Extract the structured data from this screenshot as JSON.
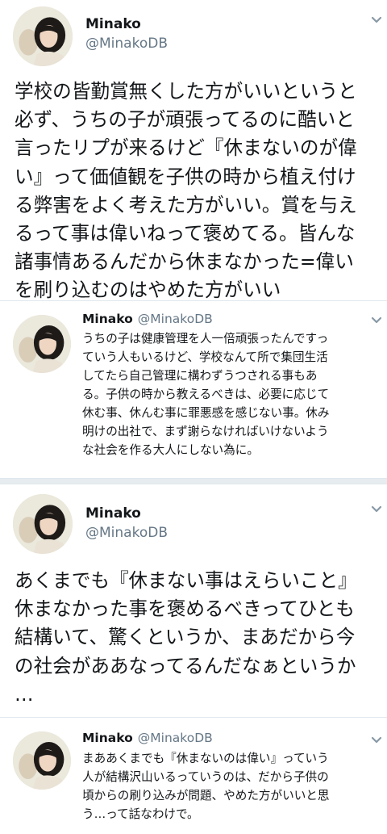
{
  "tweet1": {
    "name": "Minako",
    "handle": "@MinakoDB",
    "text": "学校の皆勤賞無くした方がいいというと\n必ず、うちの子が頑張ってるのに酷いと\n言ったリプが来るけど『休まないのが偉\nい』って価値観を子供の時から植え付け\nる弊害をよく考えた方がいい。賞を与え\nるって事は偉いねって褒めてる。皆んな\n諸事情あるんだから休まなかった=偉い\nを刷り込むのはやめた方がいい"
  },
  "reply1": {
    "name": "Minako",
    "handle": "@MinakoDB",
    "text": "うちの子は健康管理を人一倍頑張ったんですっ\nていう人もいるけど、学校なんて所で集団生活\nしてたら自己管理に構わずうつされる事もあ\nる。子供の時から教えるべきは、必要に応じて\n休む事、休んむ事に罪悪感を感じない事。休み\n明けの出社で、まず謝らなければいけないよう\nな社会を作る大人にしない為に。"
  },
  "tweet2": {
    "name": "Minako",
    "handle": "@MinakoDB",
    "text": "あくまでも『休まない事はえらいこと』\n休まなかった事を褒めるべきってひとも\n結構いて、驚くというか、まあだから今\nの社会がああなってるんだなぁというか\n…"
  },
  "reply2": {
    "name": "Minako",
    "handle": "@MinakoDB",
    "text": "まああくまでも『休まないのは偉い』っていう\n人が結構沢山いるっていうのは、だから子供の\n頃からの刷り込みが問題、やめた方がいいと思\nう…って話なわけで。"
  },
  "icons": [
    "avatar",
    "chevron-down-icon"
  ],
  "colors": {
    "text": "#14171a",
    "secondary": "#657786",
    "divider": "#e1e8ed"
  }
}
